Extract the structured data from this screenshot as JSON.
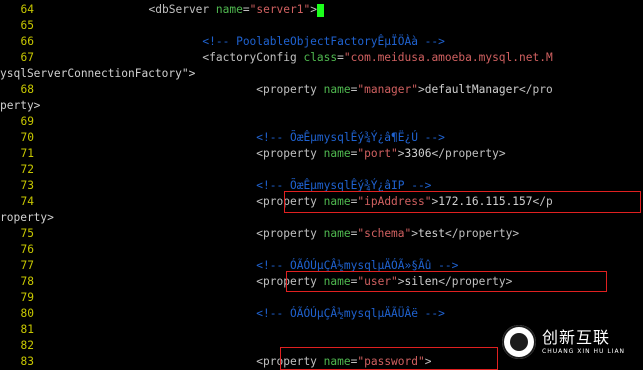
{
  "editor": {
    "lines": [
      {
        "num": "64",
        "indent": "                ",
        "tag_open": "<dbServer",
        "attr": "name",
        "eq": "=",
        "val": "\"server1\"",
        "tag_close": ">"
      },
      {
        "num": "65"
      },
      {
        "num": "66",
        "indent": "                        ",
        "comment": "<!-- PoolableObjectFactoryÊµÏÖÀà -->"
      },
      {
        "num": "67",
        "indent": "                        ",
        "tag_open": "<factoryConfig",
        "attr": "class",
        "eq": "=",
        "val": "\"com.meidusa.amoeba.mysql.net.M"
      },
      {
        "wrap": "ysqlServerConnectionFactory\">"
      },
      {
        "num": "68",
        "indent": "                                ",
        "tag_open": "<property",
        "attr": "name",
        "eq": "=",
        "val": "\"manager\"",
        "tag_close": ">",
        "text": "defaultManager",
        "end": "</pro"
      },
      {
        "wrap": "perty>"
      },
      {
        "num": "69"
      },
      {
        "num": "70",
        "indent": "                                ",
        "comment": "<!-- ÕæÊµmysqlÊý¾Ý¿â¶Ë¿Ú -->"
      },
      {
        "num": "71",
        "indent": "                                ",
        "tag_open": "<property",
        "attr": "name",
        "eq": "=",
        "val": "\"port\"",
        "tag_close": ">",
        "text": "3306",
        "end": "</property>"
      },
      {
        "num": "72"
      },
      {
        "num": "73",
        "indent": "                                ",
        "comment": "<!-- ÕæÊµmysqlÊý¾Ý¿âIP -->"
      },
      {
        "num": "74",
        "indent": "                                ",
        "tag_open": "<property",
        "attr": "name",
        "eq": "=",
        "val": "\"ipAddress\"",
        "tag_close": ">",
        "text": "172.16.115.157",
        "end": "</p"
      },
      {
        "wrap": "roperty>"
      },
      {
        "num": "75",
        "indent": "                                ",
        "tag_open": "<property",
        "attr": "name",
        "eq": "=",
        "val": "\"schema\"",
        "tag_close": ">",
        "text": "test",
        "end": "</property>"
      },
      {
        "num": "76"
      },
      {
        "num": "77",
        "indent": "                                ",
        "comment": "<!-- ÓÃÓÚµÇÂ½mysqlµÄÓÃ»§Ãû -->"
      },
      {
        "num": "78",
        "indent": "                                ",
        "tag_open": "<property",
        "attr": "name",
        "eq": "=",
        "val": "\"user\"",
        "tag_close": ">",
        "text": "silen",
        "end": "</property>"
      },
      {
        "num": "79"
      },
      {
        "num": "80",
        "indent": "                                ",
        "comment": "<!-- ÓÃÓÚµÇÂ½mysqlµÄÃÜÂë -->"
      },
      {
        "num": "81"
      },
      {
        "num": "82"
      },
      {
        "num": "83",
        "indent": "                                ",
        "tag_open": "<property",
        "attr": "name",
        "eq": "=",
        "val": "\"password\"",
        "tag_close": ">"
      }
    ]
  },
  "colors": {
    "background": "#000000",
    "line_number": "#c8c800",
    "attribute": "#4fb84f",
    "string": "#d06060",
    "comment": "#1f62d0",
    "highlight_box": "#e02020",
    "cursor": "#1cff1c"
  },
  "watermark": {
    "cn": "创新互联",
    "en": "CHUANG XIN HU LIAN",
    "icon": "watermark-logo-icon"
  }
}
